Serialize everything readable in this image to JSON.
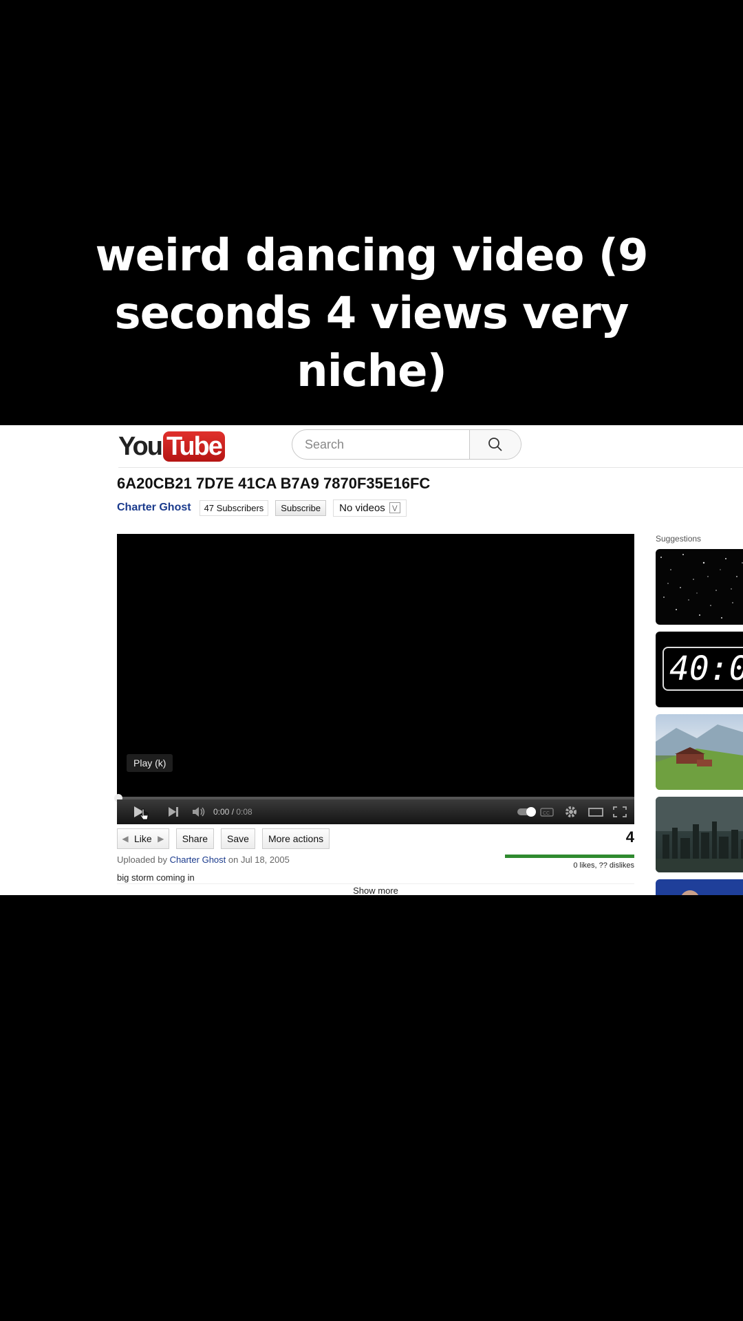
{
  "caption": {
    "text": "weird dancing video (9 seconds 4 views very niche)"
  },
  "header": {
    "logo_you": "You",
    "logo_tube": "Tube",
    "search_placeholder": "Search"
  },
  "video": {
    "title": "6A20CB21 7D7E 41CA B7A9 7870F35E16FC",
    "channel": "Charter Ghost",
    "subscribers": "47 Subscribers",
    "subscribe_label": "Subscribe",
    "videos_dropdown": "No videos",
    "tooltip": "Play (k)",
    "time_current": "0:00",
    "time_total": "0:08",
    "progress": 0
  },
  "actions": {
    "like": "Like",
    "share": "Share",
    "save": "Save",
    "more": "More actions"
  },
  "stats": {
    "views": "4",
    "likes_dislikes": "0 likes, ?? dislikes"
  },
  "upload": {
    "prefix": "Uploaded by",
    "channel": "Charter Ghost",
    "date": "on Jul 18, 2005",
    "description": "big storm coming in",
    "show_more": "Show more"
  },
  "suggestions": {
    "label": "Suggestions",
    "clock_text": "40:0"
  },
  "colors": {
    "accent_red": "#c4201c",
    "link_blue": "#1a3a8c",
    "ratio_green": "#2f8a2f"
  }
}
